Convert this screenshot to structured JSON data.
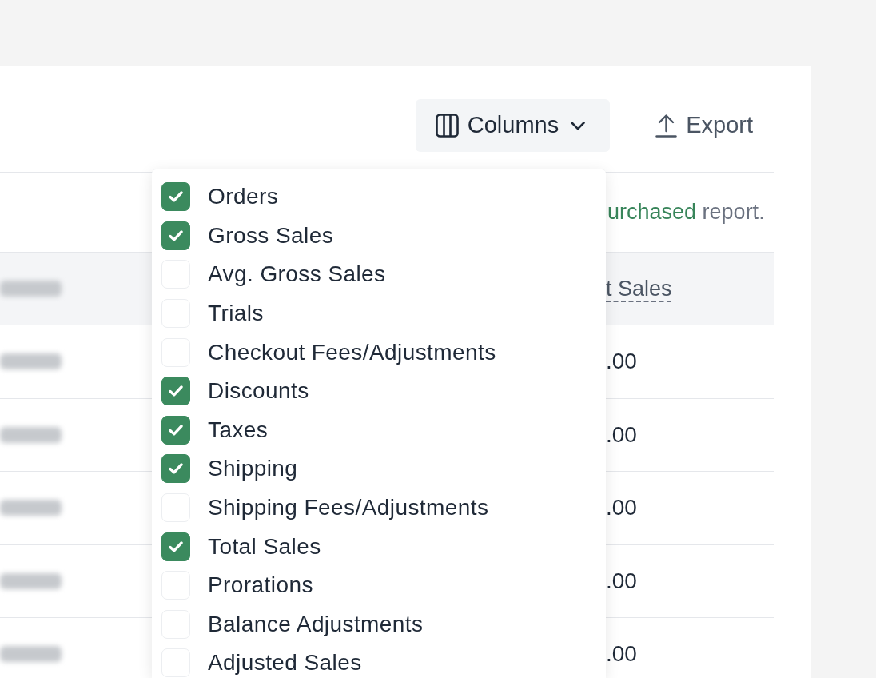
{
  "toolbar": {
    "columns_button": {
      "label": "Columns",
      "expanded": true
    },
    "export_button": {
      "label": "Export"
    }
  },
  "notice": {
    "link": "urchased",
    "text": "report."
  },
  "table": {
    "header": "t Sales",
    "rows": [
      {
        "value": ".00"
      },
      {
        "value": ".00"
      },
      {
        "value": ".00"
      },
      {
        "value": ".00"
      },
      {
        "value": ".00"
      }
    ]
  },
  "columns_menu": {
    "items": [
      {
        "label": "Orders",
        "checked": true
      },
      {
        "label": "Gross Sales",
        "checked": true
      },
      {
        "label": "Avg. Gross Sales",
        "checked": false
      },
      {
        "label": "Trials",
        "checked": false
      },
      {
        "label": "Checkout Fees/Adjustments",
        "checked": false
      },
      {
        "label": "Discounts",
        "checked": true
      },
      {
        "label": "Taxes",
        "checked": true
      },
      {
        "label": "Shipping",
        "checked": true
      },
      {
        "label": "Shipping Fees/Adjustments",
        "checked": false
      },
      {
        "label": "Total Sales",
        "checked": true
      },
      {
        "label": "Prorations",
        "checked": false
      },
      {
        "label": "Balance Adjustments",
        "checked": false
      },
      {
        "label": "Adjusted Sales",
        "checked": false
      }
    ]
  }
}
